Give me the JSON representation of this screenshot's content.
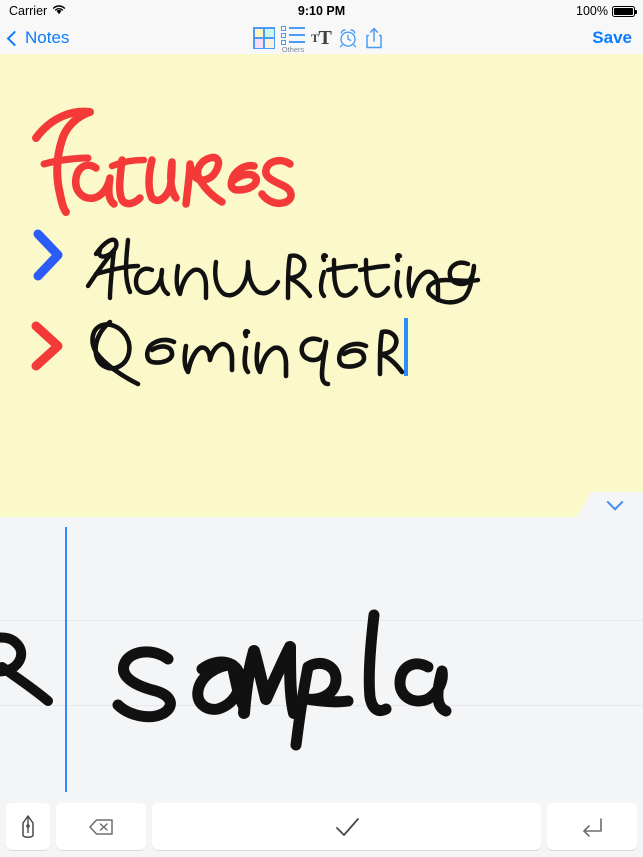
{
  "status_bar": {
    "carrier": "Carrier",
    "wifi_icon": "wifi-icon",
    "time": "9:10 PM",
    "battery_percent": "100%",
    "battery_icon": "battery-full-icon"
  },
  "nav_bar": {
    "back_label": "Notes",
    "back_icon": "chevron-left-icon",
    "save_label": "Save",
    "tools": [
      {
        "name": "grid-icon",
        "label": ""
      },
      {
        "name": "checklist-icon",
        "label": "Others"
      },
      {
        "name": "text-size-icon",
        "label_small": "T",
        "label_big": "T"
      },
      {
        "name": "alarm-clock-icon",
        "label": ""
      },
      {
        "name": "share-icon",
        "label": ""
      }
    ]
  },
  "note": {
    "background_color": "#fbf8c9",
    "title_text": "Features",
    "title_color": "#f43a38",
    "lines": [
      {
        "bullet": "chevron-right",
        "bullet_color": "#2b5cf8",
        "text": "Handwriting",
        "text_color": "#111111"
      },
      {
        "bullet": "chevron-right",
        "bullet_color": "#f43a38",
        "text": "Reminder",
        "text_color": "#111111"
      }
    ],
    "caret_color": "#2b8cfb",
    "dismiss_icon": "chevron-down-icon"
  },
  "handwriting_panel": {
    "partial_previous_text": "R",
    "current_text": "saMple",
    "ink_color": "#111111",
    "margin_line_color": "#2b8cfb",
    "guide_line_color": "#e6e8ec"
  },
  "keyboard": {
    "keys": [
      {
        "name": "pen-button",
        "icon": "pen-nib-icon"
      },
      {
        "name": "delete-button",
        "icon": "backspace-icon"
      },
      {
        "name": "confirm-button",
        "icon": "checkmark-icon"
      },
      {
        "name": "return-button",
        "icon": "return-arrow-icon"
      }
    ]
  },
  "colors": {
    "ios_blue": "#0a7cff",
    "note_yellow": "#fbf8c9",
    "panel_gray": "#f4f5f7",
    "red_ink": "#f43a38"
  }
}
